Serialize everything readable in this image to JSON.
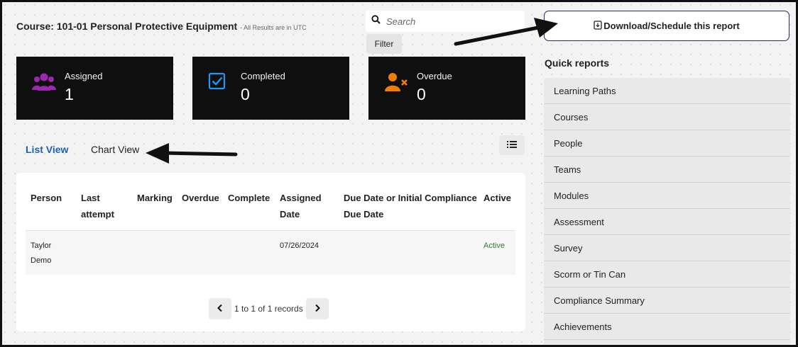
{
  "header": {
    "course_title": "Course: 101-01 Personal Protective Equipment",
    "utc_note": "- All Results are in UTC"
  },
  "search": {
    "placeholder": "Search"
  },
  "filter": {
    "label": "Filter"
  },
  "download": {
    "label": "Download/Schedule this report"
  },
  "stats": [
    {
      "label": "Assigned",
      "value": "1",
      "icon": "users-icon",
      "color": "#9c27b0"
    },
    {
      "label": "Completed",
      "value": "0",
      "icon": "checkbox-icon",
      "color": "#2196f3"
    },
    {
      "label": "Overdue",
      "value": "0",
      "icon": "user-x-icon",
      "color": "#f57c00"
    }
  ],
  "tabs": {
    "list": "List View",
    "chart": "Chart View"
  },
  "table": {
    "columns": {
      "person": "Person",
      "last_attempt_1": "Last",
      "last_attempt_2": "attempt",
      "marking": "Marking",
      "overdue": "Overdue",
      "complete": "Complete",
      "assigned_1": "Assigned",
      "assigned_2": "Date",
      "due_1": "Due Date or Initial Compliance",
      "due_2": "Due Date",
      "active": "Active"
    },
    "rows": [
      {
        "person_1": "Taylor",
        "person_2": "Demo",
        "assigned_date": "07/26/2024",
        "active": "Active"
      }
    ]
  },
  "pagination": {
    "text": "1 to 1 of 1 records"
  },
  "quick_reports": {
    "title": "Quick reports",
    "items": [
      "Learning Paths",
      "Courses",
      "People",
      "Teams",
      "Modules",
      "Assessment",
      "Survey",
      "Scorm or Tin Can",
      "Compliance Summary",
      "Achievements"
    ]
  },
  "colors": {
    "accent": "#1f5fb4",
    "active": "#2e7d32",
    "card_bg": "#0f0f0f"
  }
}
